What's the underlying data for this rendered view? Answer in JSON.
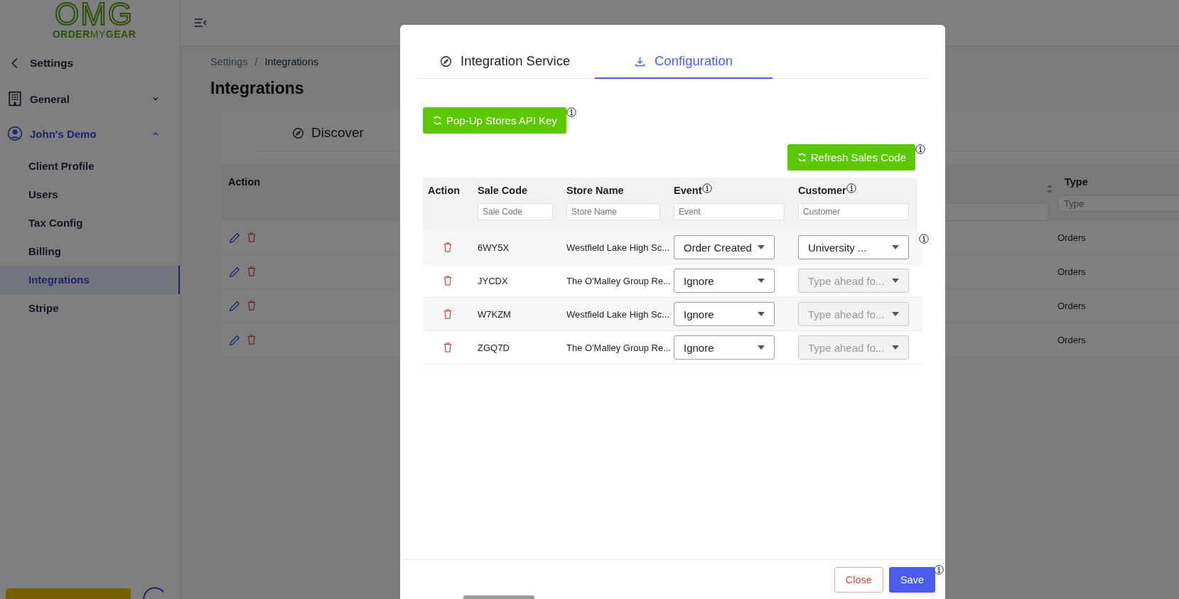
{
  "logo": {
    "mark": "OMG",
    "wordmark": [
      {
        "text": "ORDER",
        "bold": true
      },
      {
        "text": "MY",
        "bold": false
      },
      {
        "text": "GEAR",
        "bold": true
      }
    ]
  },
  "sidebar": {
    "back": "Settings",
    "groups": [
      {
        "label": "General",
        "kind": "building",
        "expanded": false,
        "active": false
      },
      {
        "label": "John's Demo",
        "kind": "user",
        "expanded": true,
        "active": true,
        "items": [
          {
            "label": "Client Profile",
            "selected": false
          },
          {
            "label": "Users",
            "selected": false
          },
          {
            "label": "Tax Config",
            "selected": false
          },
          {
            "label": "Billing",
            "selected": false
          },
          {
            "label": "Integrations",
            "selected": true
          },
          {
            "label": "Stripe",
            "selected": false
          }
        ]
      }
    ]
  },
  "breadcrumb": {
    "parent": "Settings",
    "separator": "/",
    "current": "Integrations"
  },
  "page_title": "Integrations",
  "card_tabs": [
    {
      "label": "Discover",
      "selected": false
    }
  ],
  "table": {
    "columns": [
      "Action",
      "Type"
    ],
    "type_filter_placeholder": "Type",
    "rows": [
      {
        "type": "Orders"
      },
      {
        "type": "Orders"
      },
      {
        "type": "Orders"
      },
      {
        "type": "Orders"
      }
    ]
  },
  "modal": {
    "tabs": [
      {
        "label": "Integration Service",
        "kind": "compass",
        "selected": false
      },
      {
        "label": "Configuration",
        "kind": "download",
        "selected": true
      }
    ],
    "api_key_button": {
      "label": "Pop-Up Stores API Key",
      "info": true
    },
    "refresh_button": {
      "label": "Refresh Sales Code",
      "info": true
    },
    "columns": [
      {
        "label": "Action",
        "info": false
      },
      {
        "label": "Sale Code",
        "info": false,
        "placeholder": "Sale Code"
      },
      {
        "label": "Store Name",
        "info": false,
        "placeholder": "Store Name"
      },
      {
        "label": "Event",
        "info": true,
        "placeholder": "Event"
      },
      {
        "label": "Customer",
        "info": true,
        "placeholder": "Customer"
      }
    ],
    "rows": [
      {
        "sale_code": "6WY5X",
        "store_name": "Westfield Lake High Sc...",
        "event": "Order Created",
        "customer": {
          "value": "University ...",
          "disabled": false
        },
        "info": true
      },
      {
        "sale_code": "JYCDX",
        "store_name": "The O'Malley Group Re...",
        "event": "Ignore",
        "customer": {
          "placeholder": "Type ahead fo...",
          "disabled": true
        },
        "info": false
      },
      {
        "sale_code": "W7KZM",
        "store_name": "Westfield Lake High Sc...",
        "event": "Ignore",
        "customer": {
          "placeholder": "Type ahead fo...",
          "disabled": true
        },
        "info": false
      },
      {
        "sale_code": "ZGQ7D",
        "store_name": "The O'Malley Group Re...",
        "event": "Ignore",
        "customer": {
          "placeholder": "Type ahead fo...",
          "disabled": true
        },
        "info": false
      }
    ],
    "close_button": "Close",
    "save_button": {
      "label": "Save",
      "info": true
    }
  }
}
